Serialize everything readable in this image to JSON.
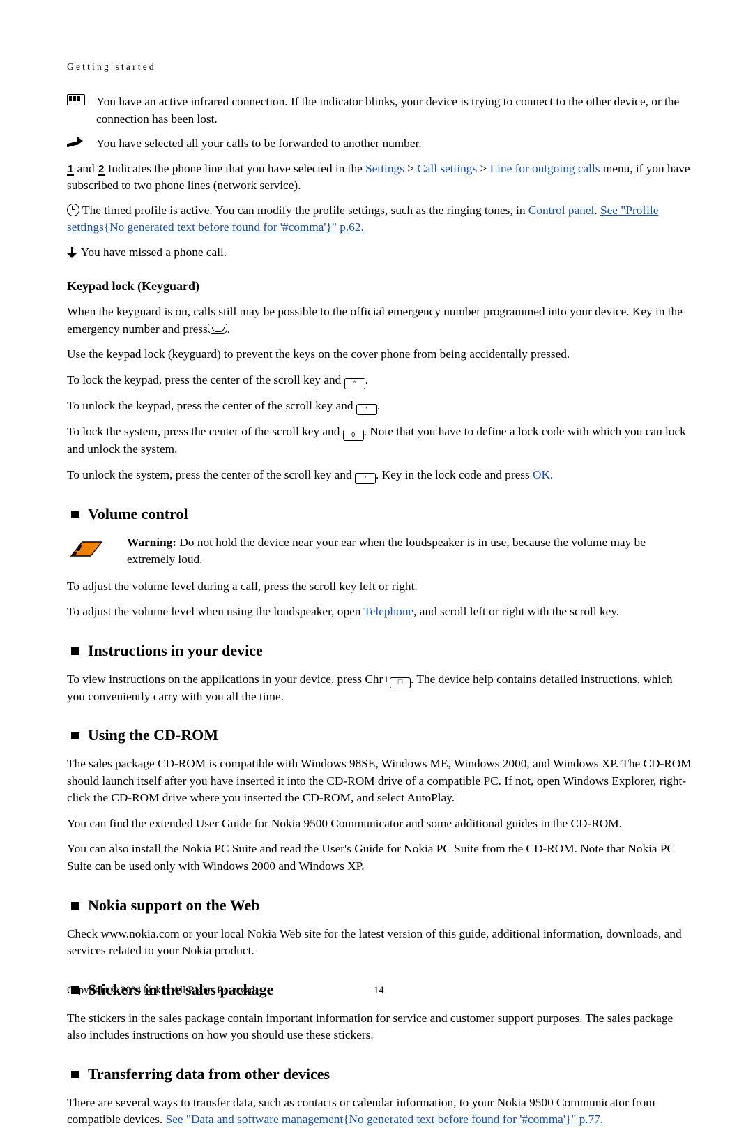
{
  "header": {
    "crumb": "Getting started"
  },
  "status_items": [
    {
      "icon": "infrared-icon",
      "text": "You have an active infrared connection. If the indicator blinks, your device is trying to connect to the other device, or the connection has been lost."
    },
    {
      "icon": "call-forward-icon",
      "text": "You have selected all your calls to be forwarded to another number."
    }
  ],
  "phone_line": {
    "num1": "1",
    "and": "and",
    "num2": "2",
    "text_a": "Indicates the phone line that you have selected in the",
    "link1": "Settings",
    "sep1": ">",
    "link2": "Call settings",
    "sep2": ">",
    "link3": "Line for outgoing calls",
    "text_b": "menu, if you have subscribed to two phone lines (network service)."
  },
  "timed_profile": {
    "icon": "clock-icon",
    "text_a": "The timed profile is active. You can modify the profile settings, such as the ringing tones, in",
    "link1": "Control panel",
    "text_b": ".",
    "link2": "See \"Profile settings{No generated text before found for '#comma'}\" p.62."
  },
  "missed_call": {
    "icon": "missed-call-icon",
    "text": "You have missed a phone call."
  },
  "keypad_lock": {
    "heading": "Keypad lock (Keyguard)",
    "p1_a": "When the keyguard is on, calls still may be possible to the official emergency number programmed into your device. Key in the emergency number and press",
    "p1_key": "call-key-icon",
    "p1_b": ".",
    "p2": "Use the keypad lock (keyguard) to prevent the keys on the cover phone from being accidentally pressed.",
    "p3_a": "To lock the keypad, press the center of the scroll key and",
    "p3_key": "*",
    "p3_b": ".",
    "p4_a": "To unlock the keypad, press the center of the scroll key and",
    "p4_key": "*",
    "p4_b": ".",
    "p5_a": "To lock the system, press the center of the scroll key and",
    "p5_key": "0",
    "p5_b": ". Note that you have to define a lock code with which you can lock and unlock the system.",
    "p6_a": "To unlock the system, press the center of the scroll key and",
    "p6_key": "*",
    "p6_b": ". Key in the lock code and press",
    "p6_link": "OK",
    "p6_c": "."
  },
  "volume_control": {
    "heading": "Volume control",
    "warning_label": "Warning:",
    "warning_text": "Do not hold the device near your ear when the loudspeaker is in use, because the volume may be extremely loud.",
    "p1": "To adjust the volume level during a call, press the scroll key left or right.",
    "p2_a": "To adjust the volume level when using the loudspeaker, open",
    "p2_link": "Telephone",
    "p2_b": ", and scroll left or right with the scroll key."
  },
  "instructions": {
    "heading": "Instructions in your device",
    "p1_a": "To view instructions on the applications in your device, press",
    "p1_chr": "Chr+",
    "p1_key": "help-key-icon",
    "p1_b": ". The device help contains detailed instructions, which you conveniently carry with you all the time."
  },
  "cdrom": {
    "heading": "Using the CD-ROM",
    "p1": "The sales package CD-ROM is compatible with Windows 98SE, Windows ME, Windows 2000, and Windows XP. The CD-ROM should launch itself after you have inserted it into the CD-ROM drive of a compatible PC. If not, open Windows Explorer, right-click the CD-ROM drive where you inserted the CD-ROM, and select AutoPlay.",
    "p2": "You can find the extended User Guide for Nokia 9500 Communicator and some additional guides in the CD-ROM.",
    "p3": "You can also install the Nokia PC Suite and read the User's Guide for Nokia PC Suite from the CD-ROM. Note that Nokia PC Suite can be used only with Windows 2000 and Windows XP."
  },
  "nokia_web": {
    "heading": "Nokia support on the Web",
    "p1": "Check www.nokia.com or your local Nokia Web site for the latest version of this guide, additional information, downloads, and services related to your Nokia product."
  },
  "stickers": {
    "heading": "Stickers in the sales package",
    "p1": "The stickers in the sales package contain important information for service and customer support purposes. The sales package also includes instructions on how you should use these stickers."
  },
  "transferring": {
    "heading": "Transferring data from other devices",
    "p1_a": "There are several ways to transfer data, such as contacts or calendar information, to your Nokia 9500 Communicator from compatible devices.",
    "p1_link": "See \"Data and software management{No generated text before found for '#comma'}\" p.77."
  },
  "footer": {
    "copyright": "Copyright © 2004 Nokia. All Rights Reserved.",
    "page_number": "14"
  },
  "colors": {
    "link": "#1b4fa0",
    "warning_orange": "#f08000",
    "text": "#000000"
  }
}
